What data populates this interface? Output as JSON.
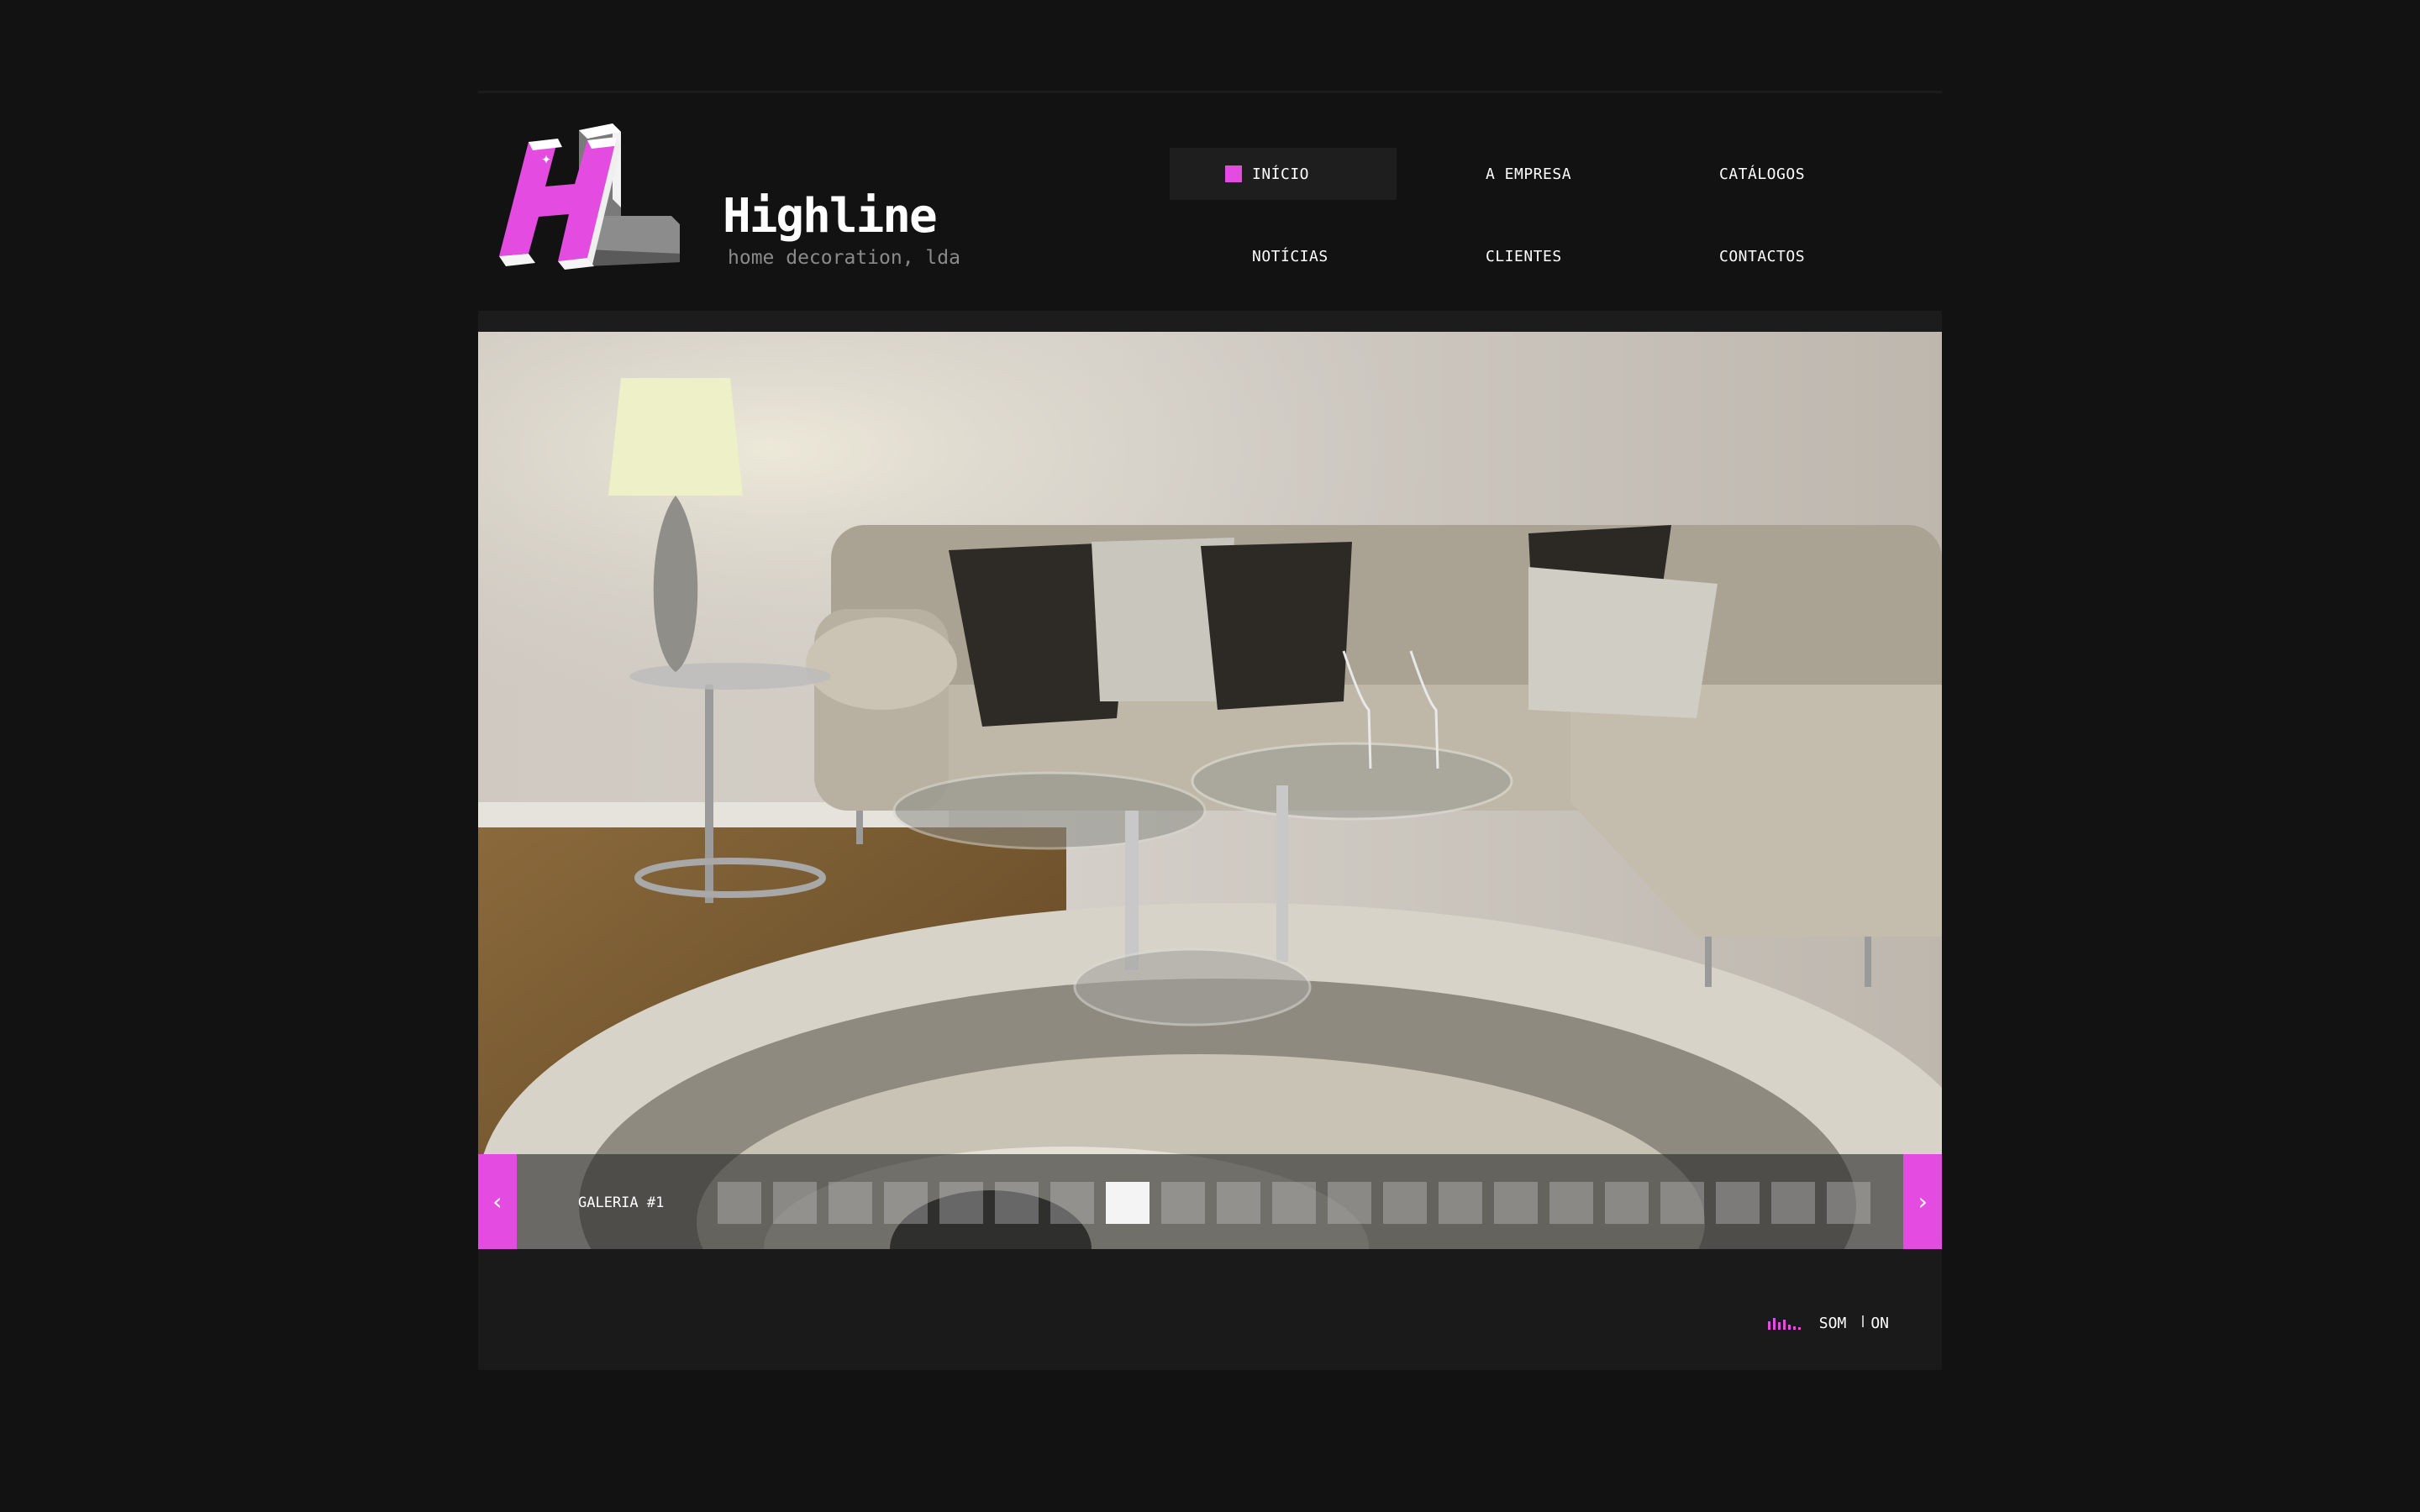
{
  "brand": {
    "name": "Highline",
    "tagline": "home decoration, lda",
    "logo_letters": "HL",
    "accent_color": "#e44be0"
  },
  "nav": {
    "items": [
      {
        "label": "INÍCIO",
        "active": true
      },
      {
        "label": "A EMPRESA",
        "active": false
      },
      {
        "label": "CATÁLOGOS",
        "active": false
      },
      {
        "label": "NOTÍCIAS",
        "active": false
      },
      {
        "label": "CLIENTES",
        "active": false
      },
      {
        "label": "CONTACTOS",
        "active": false
      }
    ]
  },
  "gallery": {
    "label": "GALERIA #1",
    "prev_icon": "chevron-left-icon",
    "next_icon": "chevron-right-icon",
    "prev_glyph": "‹",
    "next_glyph": "›",
    "thumb_count": 21,
    "active_thumb": 8
  },
  "footer": {
    "sound_label": "SOM",
    "sound_state": "ON",
    "sound_icon": "equalizer-icon"
  }
}
